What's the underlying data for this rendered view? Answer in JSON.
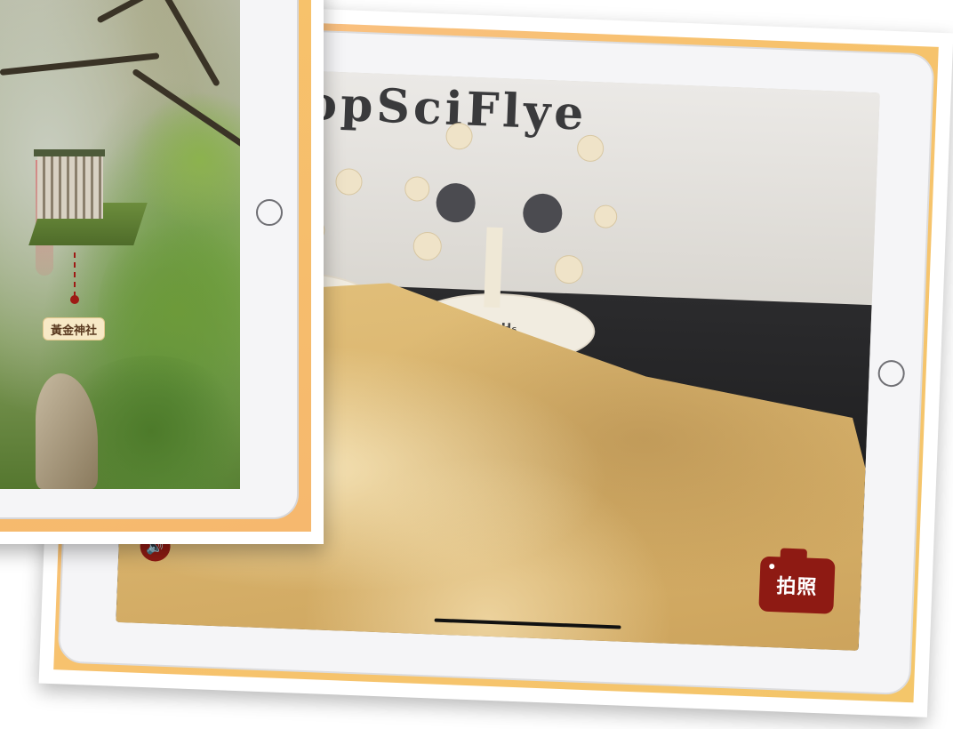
{
  "back_card": {
    "wall_banner_text": "PopSciFlye",
    "stand_labels": [
      "C₂H₆"
    ],
    "speaker_icon": "speaker-icon",
    "camera_button_label": "拍照",
    "camera_icon": "camera-icon"
  },
  "front_card": {
    "location_label": "黃金神社",
    "pin_icon": "map-pin-icon"
  },
  "colors": {
    "accent_red": "#8e1a13",
    "frame_orange": "#f7c26d",
    "sand": "#d7b16a"
  }
}
